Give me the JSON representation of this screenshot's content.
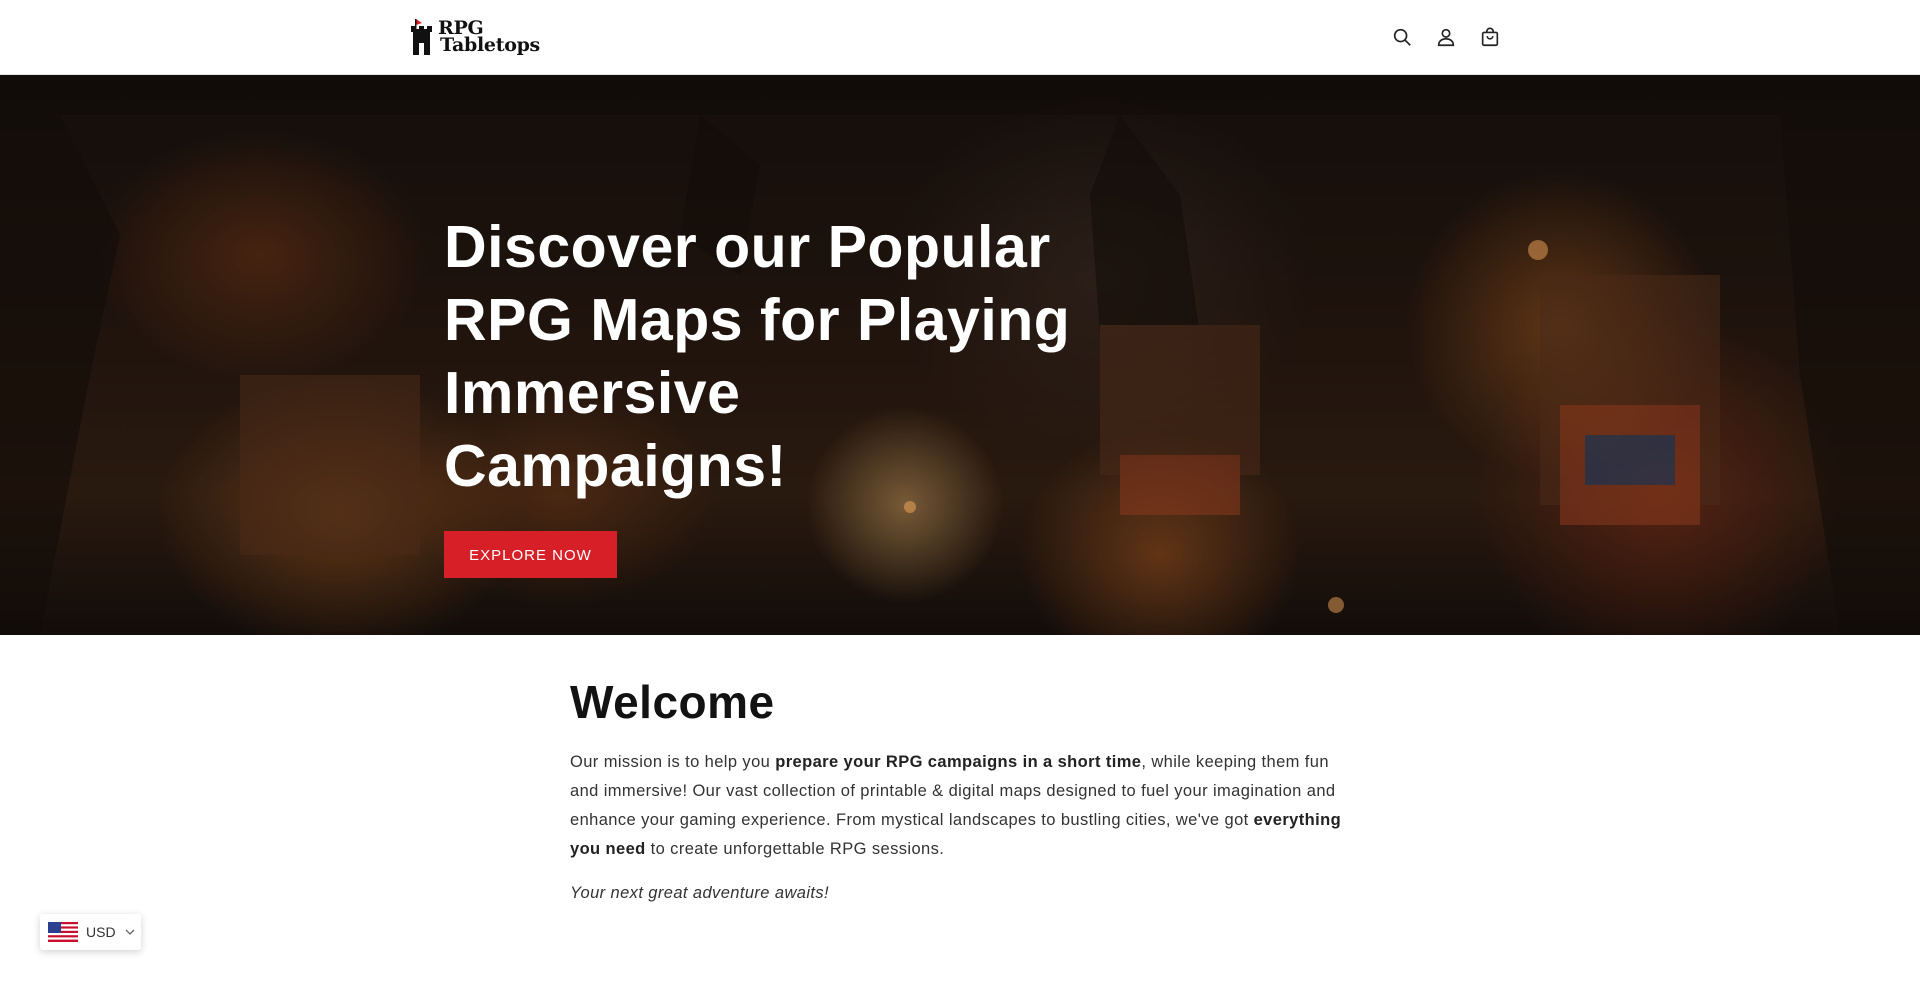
{
  "header": {
    "logo_line1": "RPG",
    "logo_line2": "Tabletops",
    "icons": [
      "search-icon",
      "account-icon",
      "cart-icon"
    ]
  },
  "hero": {
    "title": "Discover our Popular RPG Maps for Playing Immersive Campaigns!",
    "cta_label": "EXPLORE NOW",
    "cta_color": "#d61f26"
  },
  "welcome": {
    "heading": "Welcome",
    "mission_part1": "Our mission is to help you ",
    "mission_bold1": "prepare your RPG campaigns in a short time",
    "mission_part2": ", while keeping them fun and immersive! Our vast collection of printable & digital maps designed to fuel your imagination and enhance your gaming experience. From mystical landscapes to bustling cities, we've got ",
    "mission_bold2": "everything you need",
    "mission_part3": " to create unforgettable RPG sessions.",
    "tagline": "Your next great adventure awaits!"
  },
  "currency": {
    "code": "USD",
    "flag": "us-flag-icon"
  }
}
